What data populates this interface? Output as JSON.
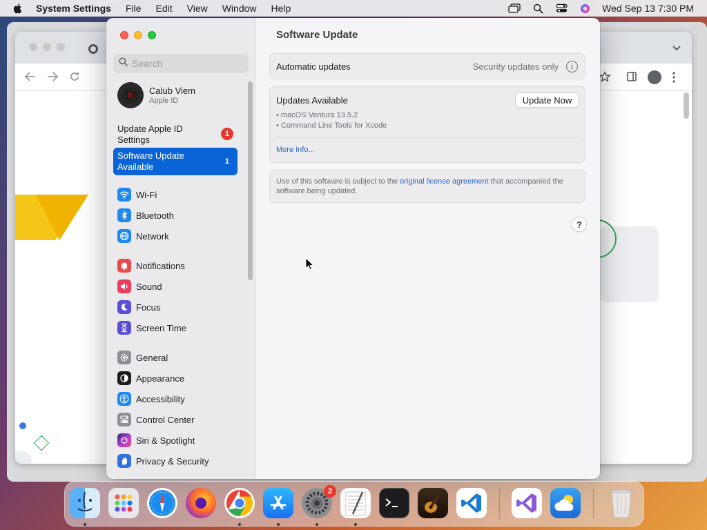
{
  "menubar": {
    "app_name": "System Settings",
    "items": [
      "File",
      "Edit",
      "View",
      "Window",
      "Help"
    ],
    "clock": "Wed Sep 13  7:30 PM"
  },
  "search": {
    "placeholder": "Search"
  },
  "account": {
    "name": "Calub Viem",
    "subtitle": "Apple ID"
  },
  "sidebar": {
    "update_apple_id": {
      "label": "Update Apple ID Settings",
      "badge": "1"
    },
    "software_update": {
      "label": "Software Update Available",
      "badge": "1"
    },
    "items": [
      {
        "label": "Wi-Fi",
        "icon": "wifi-icon",
        "color": "#1e88f0"
      },
      {
        "label": "Bluetooth",
        "icon": "bluetooth-icon",
        "color": "#1e88f0"
      },
      {
        "label": "Network",
        "icon": "globe-icon",
        "color": "#1e88f0"
      },
      {
        "label": "Notifications",
        "icon": "bell-icon",
        "color": "#ec4a4a"
      },
      {
        "label": "Sound",
        "icon": "speaker-icon",
        "color": "#ec3d5a"
      },
      {
        "label": "Focus",
        "icon": "moon-icon",
        "color": "#5a4fd6"
      },
      {
        "label": "Screen Time",
        "icon": "hourglass-icon",
        "color": "#5a4fd6"
      },
      {
        "label": "General",
        "icon": "gear-icon",
        "color": "#8e8e93"
      },
      {
        "label": "Appearance",
        "icon": "appearance-icon",
        "color": "#1c1c1e"
      },
      {
        "label": "Accessibility",
        "icon": "accessibility-icon",
        "color": "#1e88f0"
      },
      {
        "label": "Control Center",
        "icon": "control-center-icon",
        "color": "#8e8e93"
      },
      {
        "label": "Siri & Spotlight",
        "icon": "siri-icon",
        "color": "#b03ad6"
      },
      {
        "label": "Privacy & Security",
        "icon": "hand-icon",
        "color": "#2f6fe0"
      }
    ]
  },
  "main": {
    "title": "Software Update",
    "automatic_updates": {
      "label": "Automatic updates",
      "value": "Security updates only"
    },
    "updates": {
      "label": "Updates Available",
      "button": "Update Now",
      "items": [
        "• macOS Ventura 13.5.2",
        "• Command Line Tools for Xcode"
      ],
      "more_info": "More Info..."
    },
    "license": {
      "before": "Use of this software is subject to the ",
      "link": "original license agreement",
      "after": " that accompanied the software being updated."
    },
    "help": "?"
  },
  "dock": {
    "badge": "2",
    "apps": [
      {
        "name": "finder-icon",
        "running": true
      },
      {
        "name": "launchpad-icon",
        "running": false
      },
      {
        "name": "safari-icon",
        "running": false
      },
      {
        "name": "firefox-icon",
        "running": false
      },
      {
        "name": "chrome-icon",
        "running": true
      },
      {
        "name": "app-store-icon",
        "running": true
      },
      {
        "name": "system-settings-icon",
        "running": true
      },
      {
        "name": "textedit-icon",
        "running": true
      },
      {
        "name": "terminal-icon",
        "running": false
      },
      {
        "name": "garageband-icon",
        "running": false
      },
      {
        "name": "vscode-icon",
        "running": false
      },
      {
        "name": "visual-studio-icon",
        "running": false
      },
      {
        "name": "weather-icon",
        "running": false
      },
      {
        "name": "trash-icon",
        "running": false
      }
    ]
  }
}
